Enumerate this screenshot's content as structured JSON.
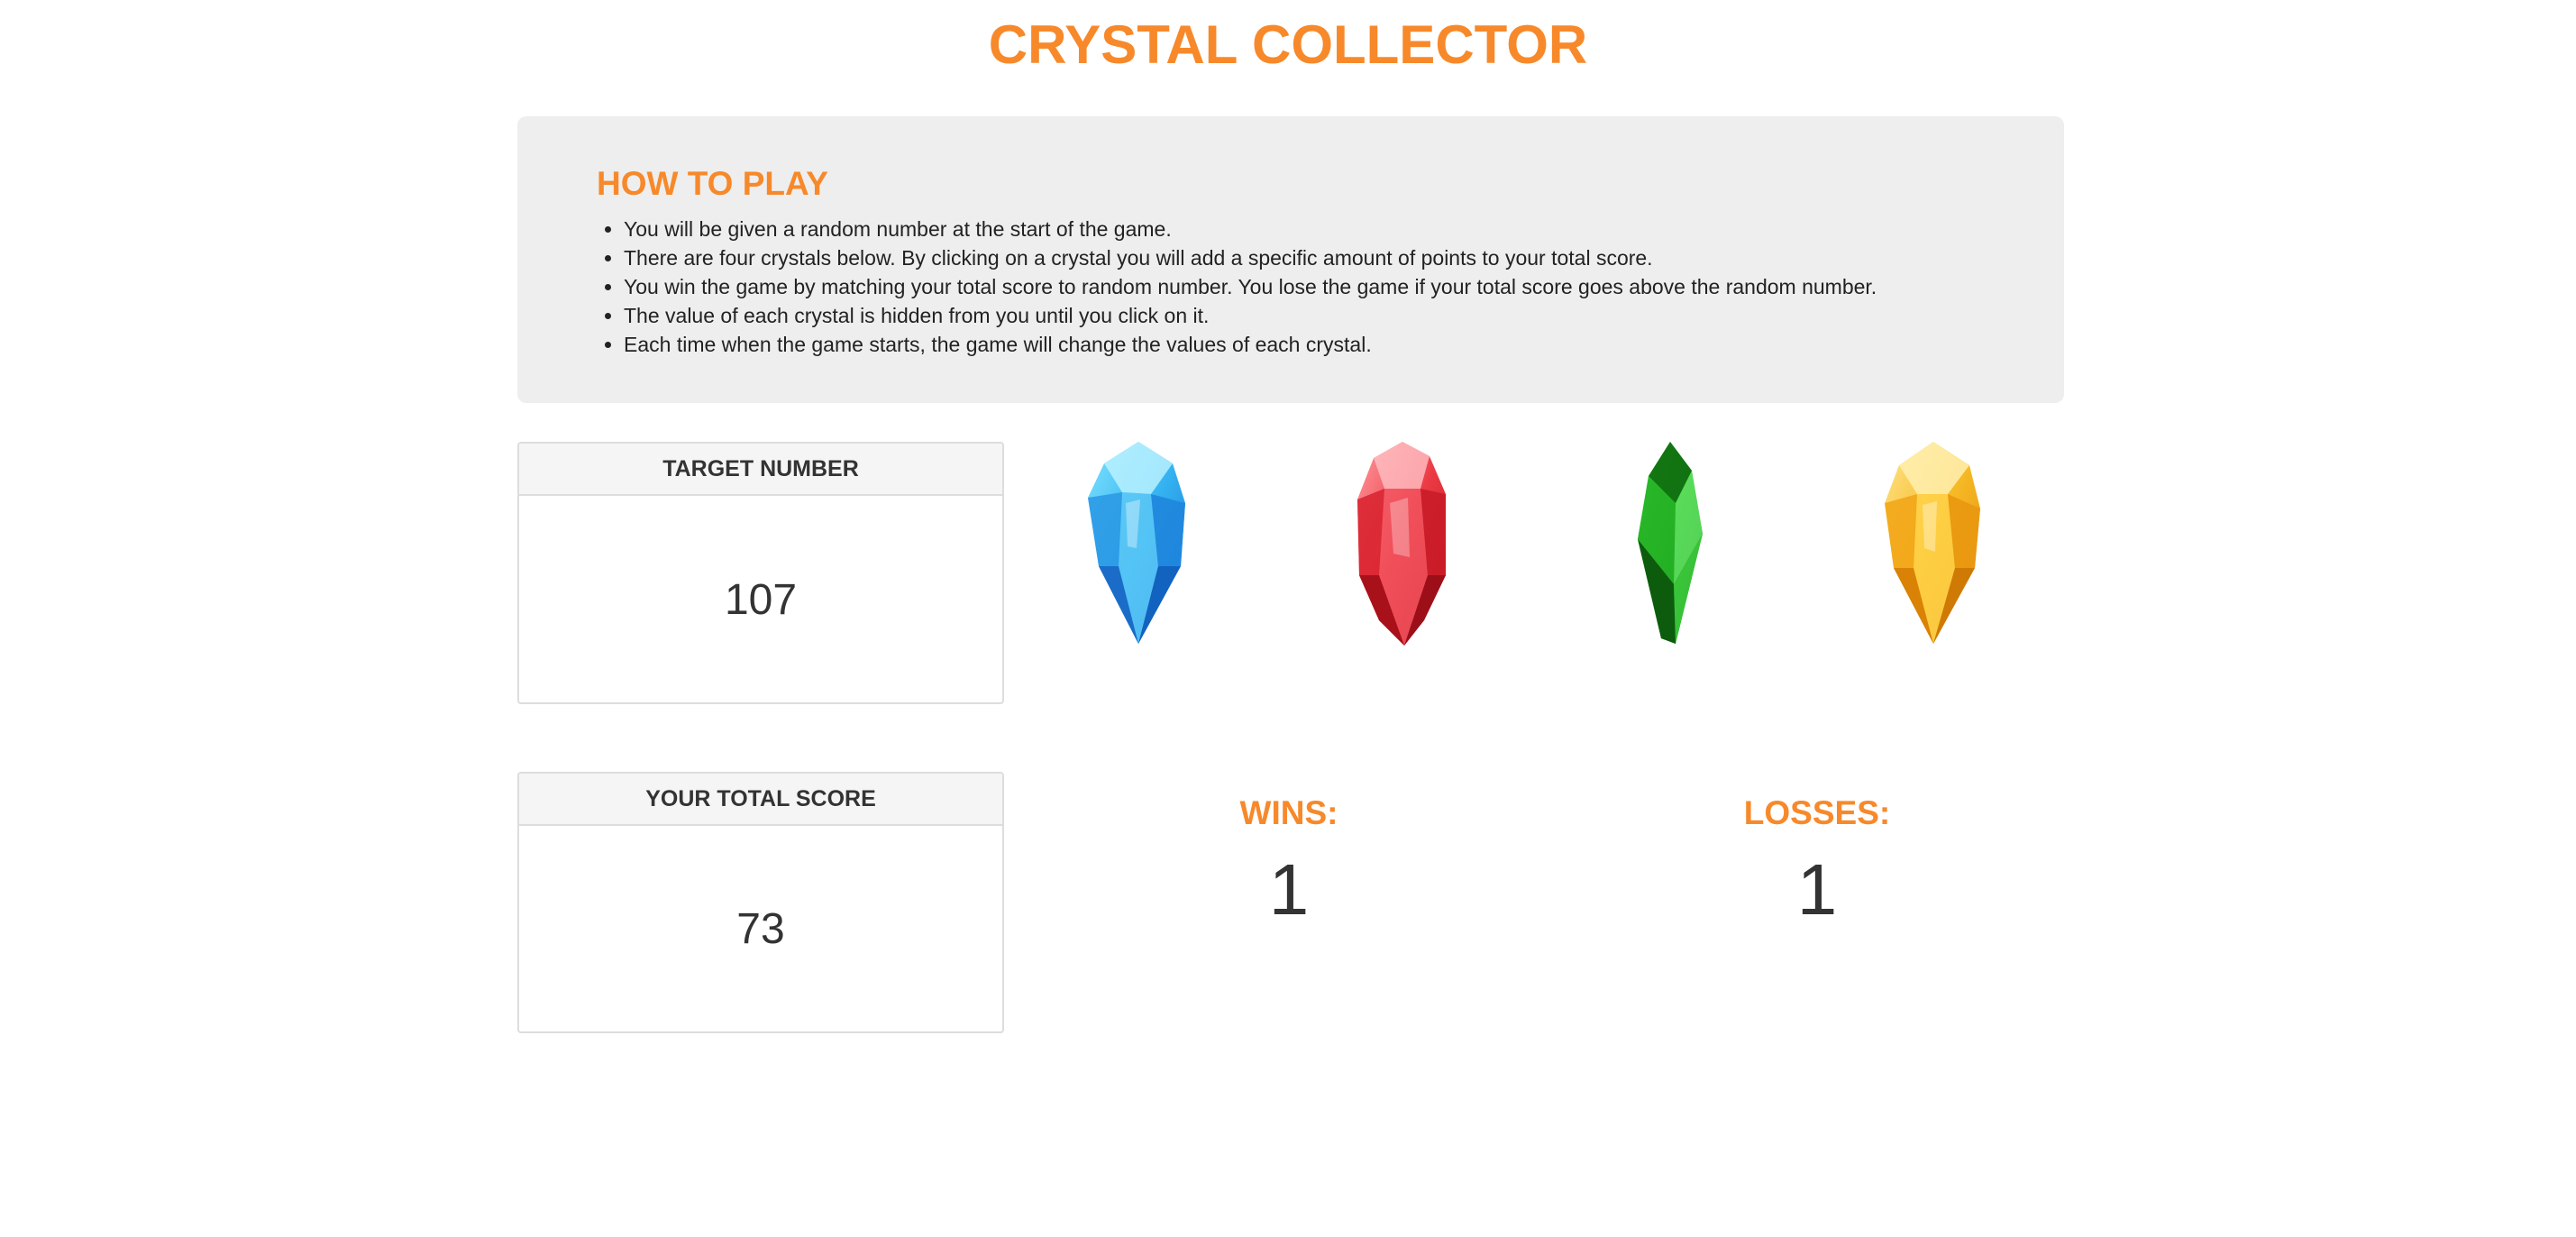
{
  "title": "CRYSTAL COLLECTOR",
  "how_to_play": {
    "heading": "HOW TO PLAY",
    "rules": [
      "You will be given a random number at the start of the game.",
      "There are four crystals below. By clicking on a crystal you will add a specific amount of points to your total score.",
      "You win the game by matching your total score to random number. You lose the game if your total score goes above the random number.",
      "The value of each crystal is hidden from you until you click on it.",
      "Each time when the game starts, the game will change the values of each crystal."
    ]
  },
  "target": {
    "label": "TARGET NUMBER",
    "value": "107"
  },
  "total_score": {
    "label": "YOUR TOTAL SCORE",
    "value": "73"
  },
  "crystals": [
    {
      "icon": "blue-crystal-icon",
      "color": "#2fa8ec"
    },
    {
      "icon": "red-crystal-icon",
      "color": "#e9373f"
    },
    {
      "icon": "green-crystal-icon",
      "color": "#1f8a1f"
    },
    {
      "icon": "yellow-crystal-icon",
      "color": "#f5b720"
    }
  ],
  "stats": {
    "wins_label": "WINS:",
    "wins_value": "1",
    "losses_label": "LOSSES:",
    "losses_value": "1"
  },
  "colors": {
    "accent": "#f7892b",
    "panel_background": "#eeeeee",
    "text": "#333333"
  }
}
